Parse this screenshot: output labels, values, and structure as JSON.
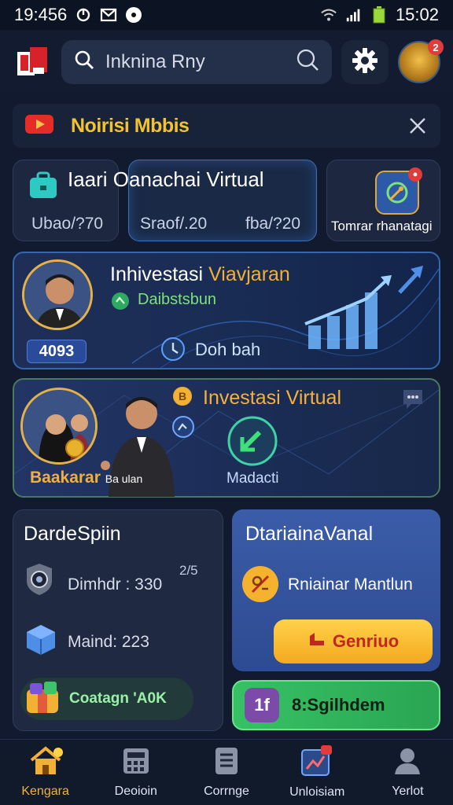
{
  "statusbar": {
    "time_left": "19:456",
    "time_right": "15:02"
  },
  "search": {
    "placeholder": "Inknina  Rny"
  },
  "avatar": {
    "badge": "2"
  },
  "notice": {
    "title": "Noirisi Mbbis"
  },
  "tiles": {
    "title": "Iaari Oanachai Virtual",
    "tile1_value": "Ubao/?70",
    "tile2_value_a": "Sraof/.20",
    "tile2_value_b": "fba/?20",
    "tile3_label": "Tomrar rhanatagi"
  },
  "banner1": {
    "title_a": "Inhivestasi ",
    "title_b": "Viavjaran",
    "subtitle": "Daibstsbun",
    "cta": "Doh bah",
    "number": "4093"
  },
  "banner2": {
    "title": "Investasi Virtual",
    "left_label": "Baakarar",
    "left_small": "Ba ulan",
    "cta": "Madacti"
  },
  "panel_left": {
    "title": "DardeSpiin",
    "row1": "Dimhdr : 330",
    "fraction": "2/5",
    "row2": "Maind: 223",
    "pill_label": "Coatagn 'A0K"
  },
  "panel_right": {
    "title": "DtariainaVanal",
    "row": "Rniainar Mantlun",
    "button": "Genriuo"
  },
  "green_button": {
    "icon_text": "1f",
    "label": "8:Sgilhdem"
  },
  "nav": [
    {
      "label": "Kengara",
      "active": true
    },
    {
      "label": "Deoioin",
      "active": false
    },
    {
      "label": "Corrnge",
      "active": false
    },
    {
      "label": "Unloisiam",
      "active": false
    },
    {
      "label": "Yerlot",
      "active": false
    }
  ],
  "colors": {
    "accent_gold": "#f2b035",
    "background": "#111a2e",
    "green": "#37c164",
    "blue_panel": "#3b5ca8"
  }
}
